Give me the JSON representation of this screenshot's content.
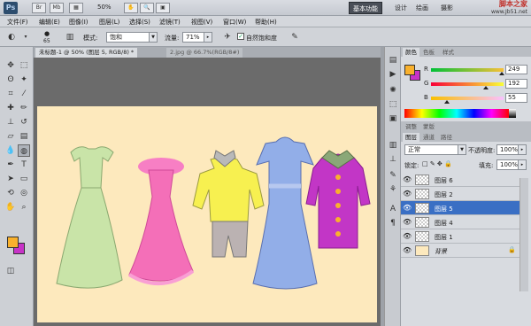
{
  "app": {
    "logo": "Ps",
    "zoom": "50%",
    "workspaces": [
      "基本功能",
      "设计",
      "绘画",
      "摄影"
    ],
    "watermark_title": "脚本之家",
    "watermark_url": "www.Jb51.net"
  },
  "menu": [
    "文件(F)",
    "编辑(E)",
    "图像(I)",
    "图层(L)",
    "选择(S)",
    "滤镜(T)",
    "视图(V)",
    "窗口(W)",
    "帮助(H)"
  ],
  "options": {
    "brush_size": "65",
    "mode_label": "模式:",
    "mode_value": "饱和",
    "flow_label": "流量:",
    "flow_value": "71%",
    "vibrance_label": "自然饱和度"
  },
  "doc_tabs": [
    "未标题-1 @ 50% (图层 5, RGB/8) *",
    "2.jpg @ 66.7%(RGB/8#)"
  ],
  "color_panel": {
    "tabs": [
      "颜色",
      "色板",
      "样式"
    ],
    "fg_color": "#f9b12d",
    "bg_color": "#c733c7",
    "channels": [
      {
        "label": "R",
        "value": "249",
        "level": 0.976
      },
      {
        "label": "G",
        "value": "192",
        "level": 0.753
      },
      {
        "label": "B",
        "value": "55",
        "level": 0.216
      }
    ]
  },
  "adjust_tabs": [
    "调整",
    "蒙版"
  ],
  "layers_panel": {
    "tabs": [
      "图层",
      "通道",
      "路径"
    ],
    "blend_mode": "正常",
    "opacity_label": "不透明度:",
    "opacity_value": "100%",
    "lock_label": "锁定:",
    "fill_label": "填充:",
    "fill_value": "100%",
    "layers": [
      {
        "name": "图层 6",
        "selected": false
      },
      {
        "name": "图层 2",
        "selected": false
      },
      {
        "name": "图层 5",
        "selected": true
      },
      {
        "name": "图层 4",
        "selected": false
      },
      {
        "name": "图层 1",
        "selected": false
      },
      {
        "name": "背景",
        "selected": false,
        "background": true
      }
    ]
  }
}
